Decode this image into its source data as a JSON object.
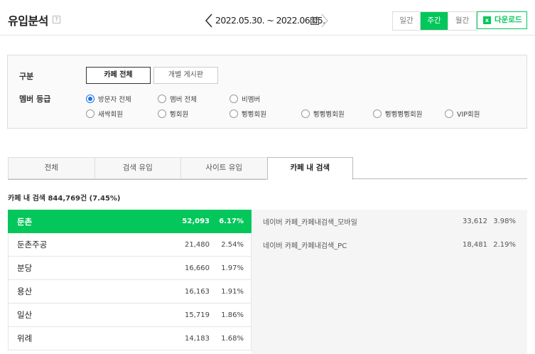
{
  "header": {
    "title": "유입분석",
    "help": "?",
    "date_range": "2022.05.30. ~ 2022.06.05.",
    "periods": [
      {
        "label": "일간",
        "active": false
      },
      {
        "label": "주간",
        "active": true
      },
      {
        "label": "월간",
        "active": false
      }
    ],
    "download_label": "다운로드",
    "excel_glyph": "x"
  },
  "filter": {
    "category_label": "구분",
    "category_options": [
      {
        "label": "카페 전체",
        "active": true
      },
      {
        "label": "개별 게시판",
        "active": false
      }
    ],
    "member_label": "멤버 등급",
    "member_options": [
      {
        "label": "방문자 전체",
        "checked": true
      },
      {
        "label": "멤버 전체",
        "checked": false
      },
      {
        "label": "비멤버",
        "checked": false
      },
      {
        "label": "새싹회원",
        "checked": false
      },
      {
        "label": "쀵회원",
        "checked": false
      },
      {
        "label": "쀵쀵회원",
        "checked": false
      },
      {
        "label": "쀵쀵쀵회원",
        "checked": false
      },
      {
        "label": "쀵쀵쀵쀵회원",
        "checked": false
      },
      {
        "label": "VIP회원",
        "checked": false
      }
    ]
  },
  "tabs": [
    {
      "label": "전체",
      "active": false
    },
    {
      "label": "검색 유입",
      "active": false
    },
    {
      "label": "사이트 유입",
      "active": false
    },
    {
      "label": "카페 내 검색",
      "active": true
    }
  ],
  "summary": "카페 내 검색 844,769건 (7.45%)",
  "keywords": [
    {
      "name": "둔촌",
      "count": "52,093",
      "pct": "6.17%",
      "active": true
    },
    {
      "name": "둔촌주공",
      "count": "21,480",
      "pct": "2.54%",
      "active": false
    },
    {
      "name": "분당",
      "count": "16,660",
      "pct": "1.97%",
      "active": false
    },
    {
      "name": "용산",
      "count": "16,163",
      "pct": "1.91%",
      "active": false
    },
    {
      "name": "일산",
      "count": "15,719",
      "pct": "1.86%",
      "active": false
    },
    {
      "name": "위례",
      "count": "14,183",
      "pct": "1.68%",
      "active": false
    }
  ],
  "details": [
    {
      "name": "네이버 카페_카페내검색_모바일",
      "count": "33,612",
      "pct": "3.98%"
    },
    {
      "name": "네이버 카페_카페내검색_PC",
      "count": "18,481",
      "pct": "2.19%"
    }
  ],
  "colors": {
    "accent": "#03c75a",
    "radio": "#1a73e8"
  }
}
